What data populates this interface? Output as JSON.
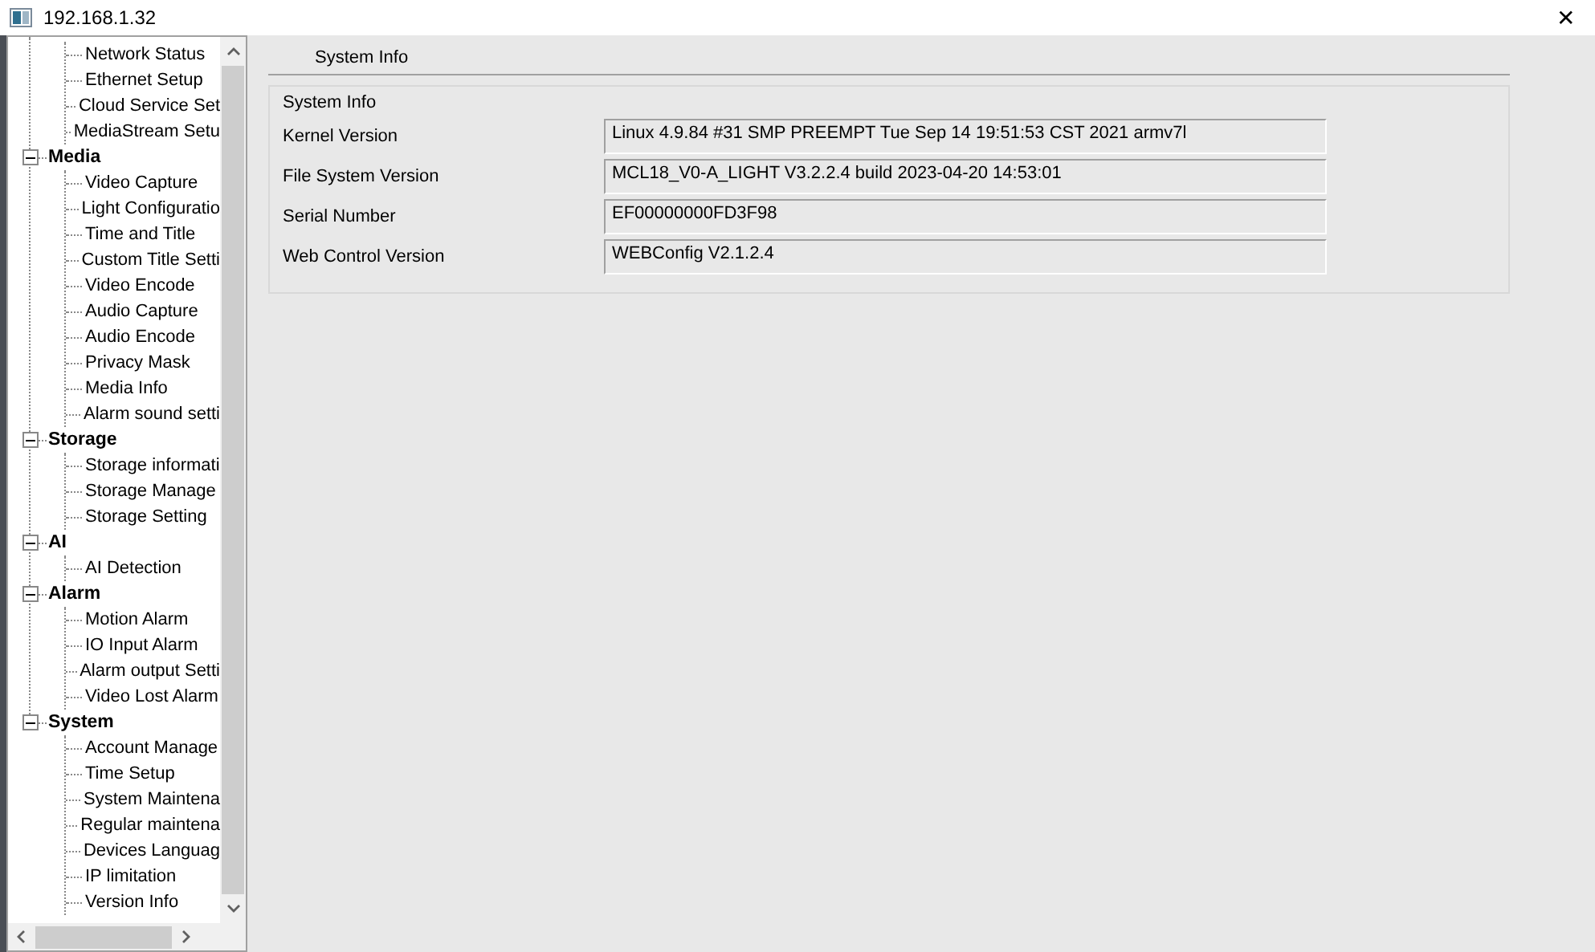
{
  "window": {
    "title": "192.168.1.32",
    "close": "✕"
  },
  "tree": [
    {
      "children": [
        {
          "label": "Network Status"
        },
        {
          "label": "Ethernet Setup"
        },
        {
          "label": "Cloud Service Set"
        },
        {
          "label": "MediaStream Setu"
        }
      ]
    },
    {
      "label": "Media",
      "expanded": true,
      "children": [
        {
          "label": "Video Capture"
        },
        {
          "label": "Light Configuratio"
        },
        {
          "label": "Time and Title"
        },
        {
          "label": "Custom Title Setti"
        },
        {
          "label": "Video Encode"
        },
        {
          "label": "Audio Capture"
        },
        {
          "label": "Audio Encode"
        },
        {
          "label": "Privacy Mask"
        },
        {
          "label": "Media Info"
        },
        {
          "label": "Alarm sound setti"
        }
      ]
    },
    {
      "label": "Storage",
      "expanded": true,
      "children": [
        {
          "label": "Storage informati"
        },
        {
          "label": "Storage Manage"
        },
        {
          "label": "Storage Setting"
        }
      ]
    },
    {
      "label": "AI",
      "expanded": true,
      "children": [
        {
          "label": "AI Detection"
        }
      ]
    },
    {
      "label": "Alarm",
      "expanded": true,
      "children": [
        {
          "label": "Motion Alarm"
        },
        {
          "label": "IO Input Alarm"
        },
        {
          "label": "Alarm output Setti"
        },
        {
          "label": "Video Lost Alarm"
        }
      ]
    },
    {
      "label": "System",
      "expanded": true,
      "children": [
        {
          "label": "Account Manage"
        },
        {
          "label": "Time Setup"
        },
        {
          "label": "System Maintena"
        },
        {
          "label": "Regular maintena"
        },
        {
          "label": "Devices Languag"
        },
        {
          "label": "IP limitation"
        },
        {
          "label": "Version Info"
        }
      ]
    }
  ],
  "tab": {
    "label": "System Info"
  },
  "group": {
    "title": "System Info",
    "fields": [
      {
        "label": "Kernel Version",
        "value": "Linux 4.9.84 #31 SMP PREEMPT Tue Sep 14 19:51:53 CST 2021 armv7l"
      },
      {
        "label": "File System Version",
        "value": "MCL18_V0-A_LIGHT V3.2.2.4 build 2023-04-20 14:53:01"
      },
      {
        "label": "Serial Number",
        "value": "EF00000000FD3F98"
      },
      {
        "label": "Web Control Version",
        "value": "WEBConfig V2.1.2.4"
      }
    ]
  }
}
